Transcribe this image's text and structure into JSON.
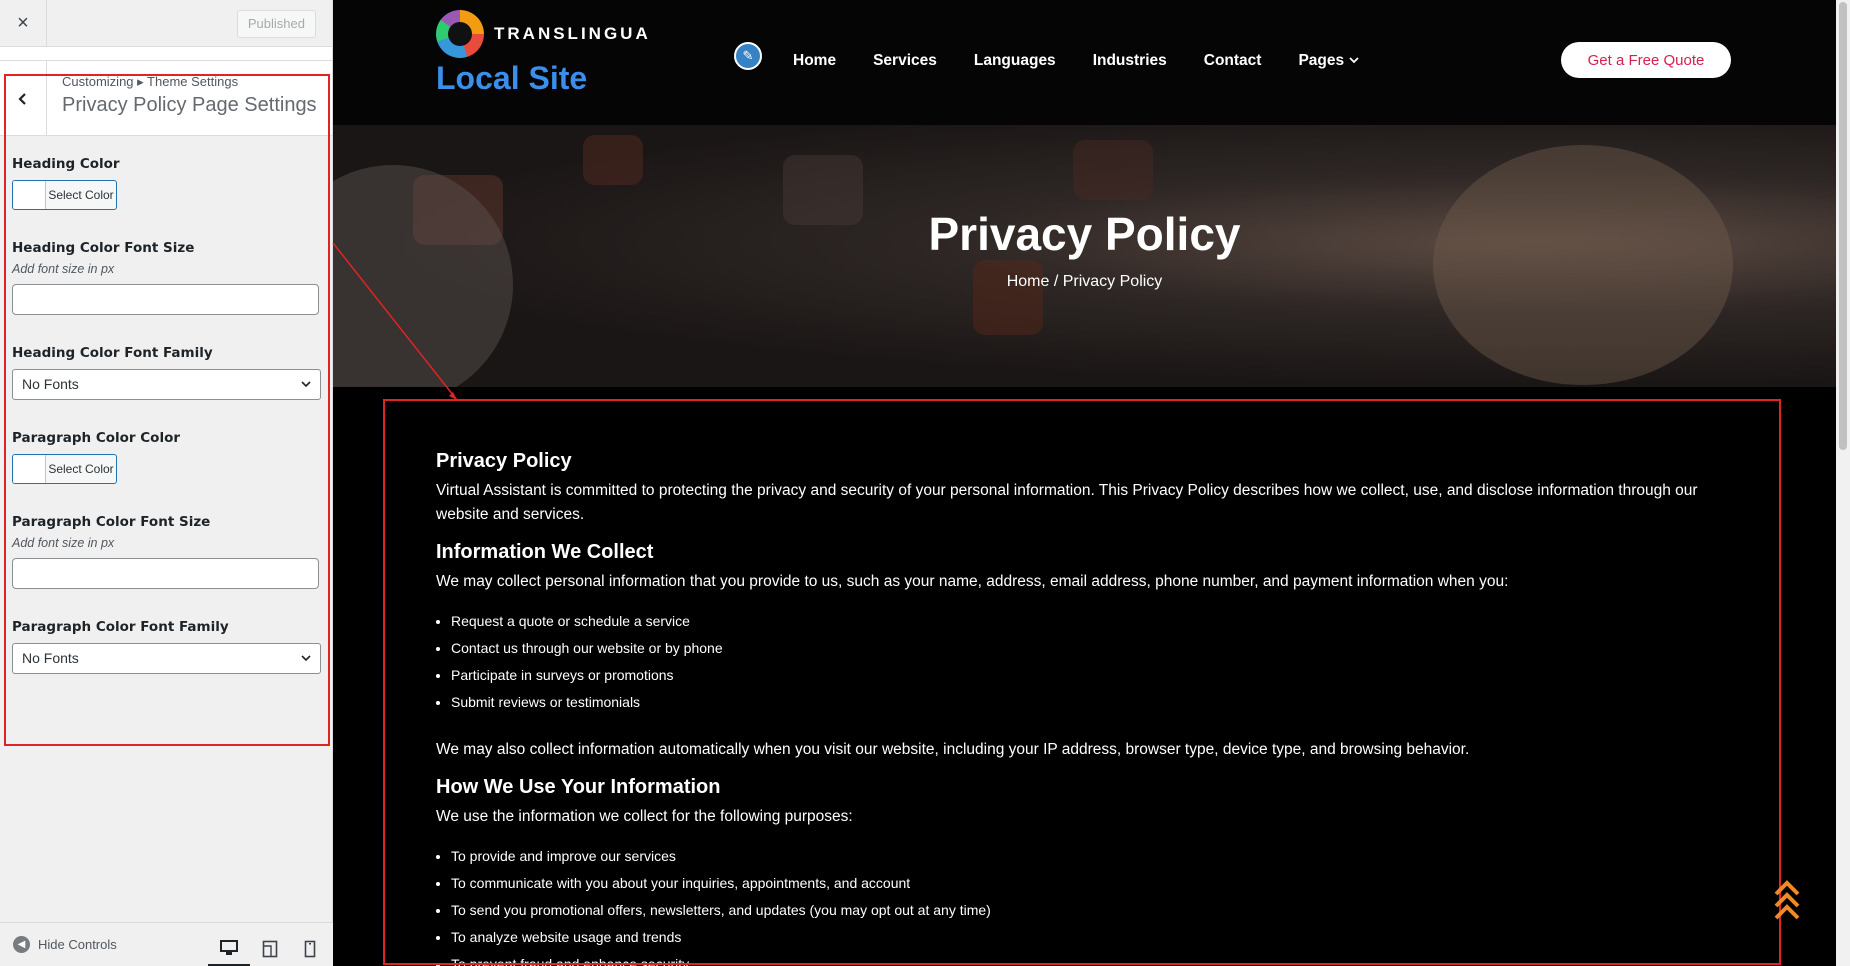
{
  "customizer": {
    "close_label": "×",
    "publish_label": "Published",
    "breadcrumb": "Customizing ▸ Theme Settings",
    "section_title": "Privacy Policy Page Settings",
    "controls": {
      "heading_color": {
        "label": "Heading Color",
        "button": "Select Color"
      },
      "heading_font_size": {
        "label": "Heading Color Font Size",
        "description": "Add font size in px",
        "value": ""
      },
      "heading_font_family": {
        "label": "Heading Color Font Family",
        "selected": "No Fonts"
      },
      "paragraph_color": {
        "label": "Paragraph Color Color",
        "button": "Select Color"
      },
      "paragraph_font_size": {
        "label": "Paragraph Color Font Size",
        "description": "Add font size in px",
        "value": ""
      },
      "paragraph_font_family": {
        "label": "Paragraph Color Font Family",
        "selected": "No Fonts"
      }
    },
    "footer": {
      "hide_controls": "Hide Controls"
    }
  },
  "site": {
    "brand": "TRANSLINGUA",
    "title": "Local Site",
    "nav": [
      "Home",
      "Services",
      "Languages",
      "Industries",
      "Contact",
      "Pages"
    ],
    "cta": "Get a Free Quote",
    "hero_title": "Privacy Policy",
    "hero_breadcrumb": "Home / Privacy Policy"
  },
  "policy": {
    "h1": "Privacy Policy",
    "p1": "Virtual Assistant is committed to protecting the privacy and security of your personal information. This Privacy Policy describes how we collect, use, and disclose information through our website and services.",
    "h2": "Information We Collect",
    "p2": "We may collect personal information that you provide to us, such as your name, address, email address, phone number, and payment information when you:",
    "list1": [
      "Request a quote or schedule a service",
      "Contact us through our website or by phone",
      "Participate in surveys or promotions",
      "Submit reviews or testimonials"
    ],
    "p3": "We may also collect information automatically when you visit our website, including your IP address, browser type, device type, and browsing behavior.",
    "h3": "How We Use Your Information",
    "p4": "We use the information we collect for the following purposes:",
    "list2": [
      "To provide and improve our services",
      "To communicate with you about your inquiries, appointments, and account",
      "To send you promotional offers, newsletters, and updates (you may opt out at any time)",
      "To analyze website usage and trends",
      "To prevent fraud and enhance security"
    ]
  },
  "colors": {
    "accent": "#2271b1",
    "site_title": "#3b8eea",
    "cta_text": "#d6204f",
    "highlight_box": "#e02424",
    "scroll_top": "#f08a24"
  },
  "icons": [
    "close-icon",
    "back-icon",
    "pencil-icon",
    "chevron-down-icon",
    "desktop-icon",
    "tablet-icon",
    "mobile-icon",
    "scroll-top-icon"
  ]
}
